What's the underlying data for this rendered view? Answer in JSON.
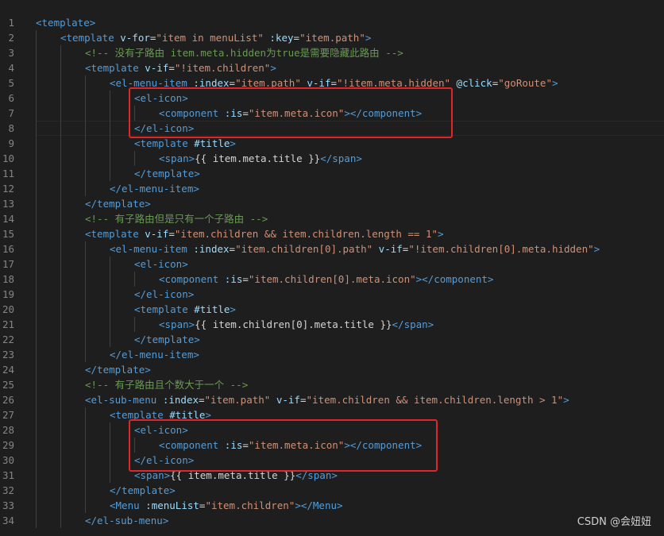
{
  "editor": {
    "lines": [
      {
        "n": "1",
        "indent": 0,
        "tokens": [
          [
            "tag",
            "<template>"
          ]
        ]
      },
      {
        "n": "2",
        "indent": 1,
        "tokens": [
          [
            "tag",
            "<template"
          ],
          [
            "attr",
            " v-for"
          ],
          [
            "txt",
            "="
          ],
          [
            "str",
            "\"item in menuList\""
          ],
          [
            "attr",
            " :key"
          ],
          [
            "txt",
            "="
          ],
          [
            "str",
            "\"item.path\""
          ],
          [
            "tag",
            ">"
          ]
        ]
      },
      {
        "n": "3",
        "indent": 2,
        "tokens": [
          [
            "cmt",
            "<!-- 没有子路由 item.meta.hidden为true是需要隐藏此路由 -->"
          ]
        ]
      },
      {
        "n": "4",
        "indent": 2,
        "tokens": [
          [
            "tag",
            "<template"
          ],
          [
            "attr",
            " v-if"
          ],
          [
            "txt",
            "="
          ],
          [
            "str",
            "\"!item.children\""
          ],
          [
            "tag",
            ">"
          ]
        ]
      },
      {
        "n": "5",
        "indent": 3,
        "tokens": [
          [
            "tag",
            "<el-menu-item"
          ],
          [
            "attr",
            " :index"
          ],
          [
            "txt",
            "="
          ],
          [
            "str",
            "\"item.path\""
          ],
          [
            "attr",
            " v-if"
          ],
          [
            "txt",
            "="
          ],
          [
            "str",
            "\"!item.meta.hidden\""
          ],
          [
            "attr",
            " @click"
          ],
          [
            "txt",
            "="
          ],
          [
            "str",
            "\"goRoute\""
          ],
          [
            "tag",
            ">"
          ]
        ]
      },
      {
        "n": "6",
        "indent": 4,
        "tokens": [
          [
            "tag",
            "<el-icon>"
          ]
        ]
      },
      {
        "n": "7",
        "indent": 5,
        "tokens": [
          [
            "tag",
            "<component"
          ],
          [
            "attr",
            " :is"
          ],
          [
            "txt",
            "="
          ],
          [
            "str",
            "\"item.meta.icon\""
          ],
          [
            "tag",
            "></component>"
          ]
        ]
      },
      {
        "n": "8",
        "indent": 4,
        "tokens": [
          [
            "tag",
            "</el-icon>"
          ]
        ]
      },
      {
        "n": "9",
        "indent": 4,
        "tokens": [
          [
            "tag",
            "<template"
          ],
          [
            "attr",
            " #title"
          ],
          [
            "tag",
            ">"
          ]
        ]
      },
      {
        "n": "10",
        "indent": 5,
        "tokens": [
          [
            "tag",
            "<span>"
          ],
          [
            "txt",
            "{{ item.meta.title }}"
          ],
          [
            "tag",
            "</span>"
          ]
        ]
      },
      {
        "n": "11",
        "indent": 4,
        "tokens": [
          [
            "tag",
            "</template>"
          ]
        ]
      },
      {
        "n": "12",
        "indent": 3,
        "tokens": [
          [
            "tag",
            "</el-menu-item>"
          ]
        ]
      },
      {
        "n": "13",
        "indent": 2,
        "tokens": [
          [
            "tag",
            "</template>"
          ]
        ]
      },
      {
        "n": "14",
        "indent": 2,
        "tokens": [
          [
            "cmt",
            "<!-- 有子路由但是只有一个子路由 -->"
          ]
        ]
      },
      {
        "n": "15",
        "indent": 2,
        "tokens": [
          [
            "tag",
            "<template"
          ],
          [
            "attr",
            " v-if"
          ],
          [
            "txt",
            "="
          ],
          [
            "str",
            "\"item.children && item.children.length == 1\""
          ],
          [
            "tag",
            ">"
          ]
        ]
      },
      {
        "n": "16",
        "indent": 3,
        "tokens": [
          [
            "tag",
            "<el-menu-item"
          ],
          [
            "attr",
            " :index"
          ],
          [
            "txt",
            "="
          ],
          [
            "str",
            "\"item.children[0].path\""
          ],
          [
            "attr",
            " v-if"
          ],
          [
            "txt",
            "="
          ],
          [
            "str",
            "\"!item.children[0].meta.hidden\""
          ],
          [
            "tag",
            ">"
          ]
        ]
      },
      {
        "n": "17",
        "indent": 4,
        "tokens": [
          [
            "tag",
            "<el-icon>"
          ]
        ]
      },
      {
        "n": "18",
        "indent": 5,
        "tokens": [
          [
            "tag",
            "<component"
          ],
          [
            "attr",
            " :is"
          ],
          [
            "txt",
            "="
          ],
          [
            "str",
            "\"item.children[0].meta.icon\""
          ],
          [
            "tag",
            "></component>"
          ]
        ]
      },
      {
        "n": "19",
        "indent": 4,
        "tokens": [
          [
            "tag",
            "</el-icon>"
          ]
        ]
      },
      {
        "n": "20",
        "indent": 4,
        "tokens": [
          [
            "tag",
            "<template"
          ],
          [
            "attr",
            " #title"
          ],
          [
            "tag",
            ">"
          ]
        ]
      },
      {
        "n": "21",
        "indent": 5,
        "tokens": [
          [
            "tag",
            "<span>"
          ],
          [
            "txt",
            "{{ item.children[0].meta.title }}"
          ],
          [
            "tag",
            "</span>"
          ]
        ]
      },
      {
        "n": "22",
        "indent": 4,
        "tokens": [
          [
            "tag",
            "</template>"
          ]
        ]
      },
      {
        "n": "23",
        "indent": 3,
        "tokens": [
          [
            "tag",
            "</el-menu-item>"
          ]
        ]
      },
      {
        "n": "24",
        "indent": 2,
        "tokens": [
          [
            "tag",
            "</template>"
          ]
        ]
      },
      {
        "n": "25",
        "indent": 2,
        "tokens": [
          [
            "cmt",
            "<!-- 有子路由且个数大于一个 -->"
          ]
        ]
      },
      {
        "n": "26",
        "indent": 2,
        "tokens": [
          [
            "tag",
            "<el-sub-menu"
          ],
          [
            "attr",
            " :index"
          ],
          [
            "txt",
            "="
          ],
          [
            "str",
            "\"item.path\""
          ],
          [
            "attr",
            " v-if"
          ],
          [
            "txt",
            "="
          ],
          [
            "str",
            "\"item.children && item.children.length > 1\""
          ],
          [
            "tag",
            ">"
          ]
        ]
      },
      {
        "n": "27",
        "indent": 3,
        "tokens": [
          [
            "tag",
            "<template"
          ],
          [
            "attr",
            " #title"
          ],
          [
            "tag",
            ">"
          ]
        ]
      },
      {
        "n": "28",
        "indent": 4,
        "tokens": [
          [
            "tag",
            "<el-icon>"
          ]
        ]
      },
      {
        "n": "29",
        "indent": 5,
        "tokens": [
          [
            "tag",
            "<component"
          ],
          [
            "attr",
            " :is"
          ],
          [
            "txt",
            "="
          ],
          [
            "str",
            "\"item.meta.icon\""
          ],
          [
            "tag",
            "></component>"
          ]
        ]
      },
      {
        "n": "30",
        "indent": 4,
        "tokens": [
          [
            "tag",
            "</el-icon>"
          ]
        ]
      },
      {
        "n": "31",
        "indent": 4,
        "tokens": [
          [
            "tag",
            "<span>"
          ],
          [
            "txt",
            "{{ item.meta.title }}"
          ],
          [
            "tag",
            "</span>"
          ]
        ]
      },
      {
        "n": "32",
        "indent": 3,
        "tokens": [
          [
            "tag",
            "</template>"
          ]
        ]
      },
      {
        "n": "33",
        "indent": 3,
        "tokens": [
          [
            "tag",
            "<Menu"
          ],
          [
            "attr",
            " :menuList"
          ],
          [
            "txt",
            "="
          ],
          [
            "str",
            "\"item.children\""
          ],
          [
            "tag",
            "></Menu>"
          ]
        ]
      },
      {
        "n": "34",
        "indent": 2,
        "tokens": [
          [
            "tag",
            "</el-sub-menu>"
          ]
        ]
      }
    ]
  },
  "watermark": "CSDN @会妞妞",
  "colors": {
    "background": "#1e1e1e",
    "tag": "#569cd6",
    "attribute": "#9cdcfe",
    "string": "#ce9178",
    "comment": "#6a9955",
    "highlight_box": "#e0262b"
  }
}
